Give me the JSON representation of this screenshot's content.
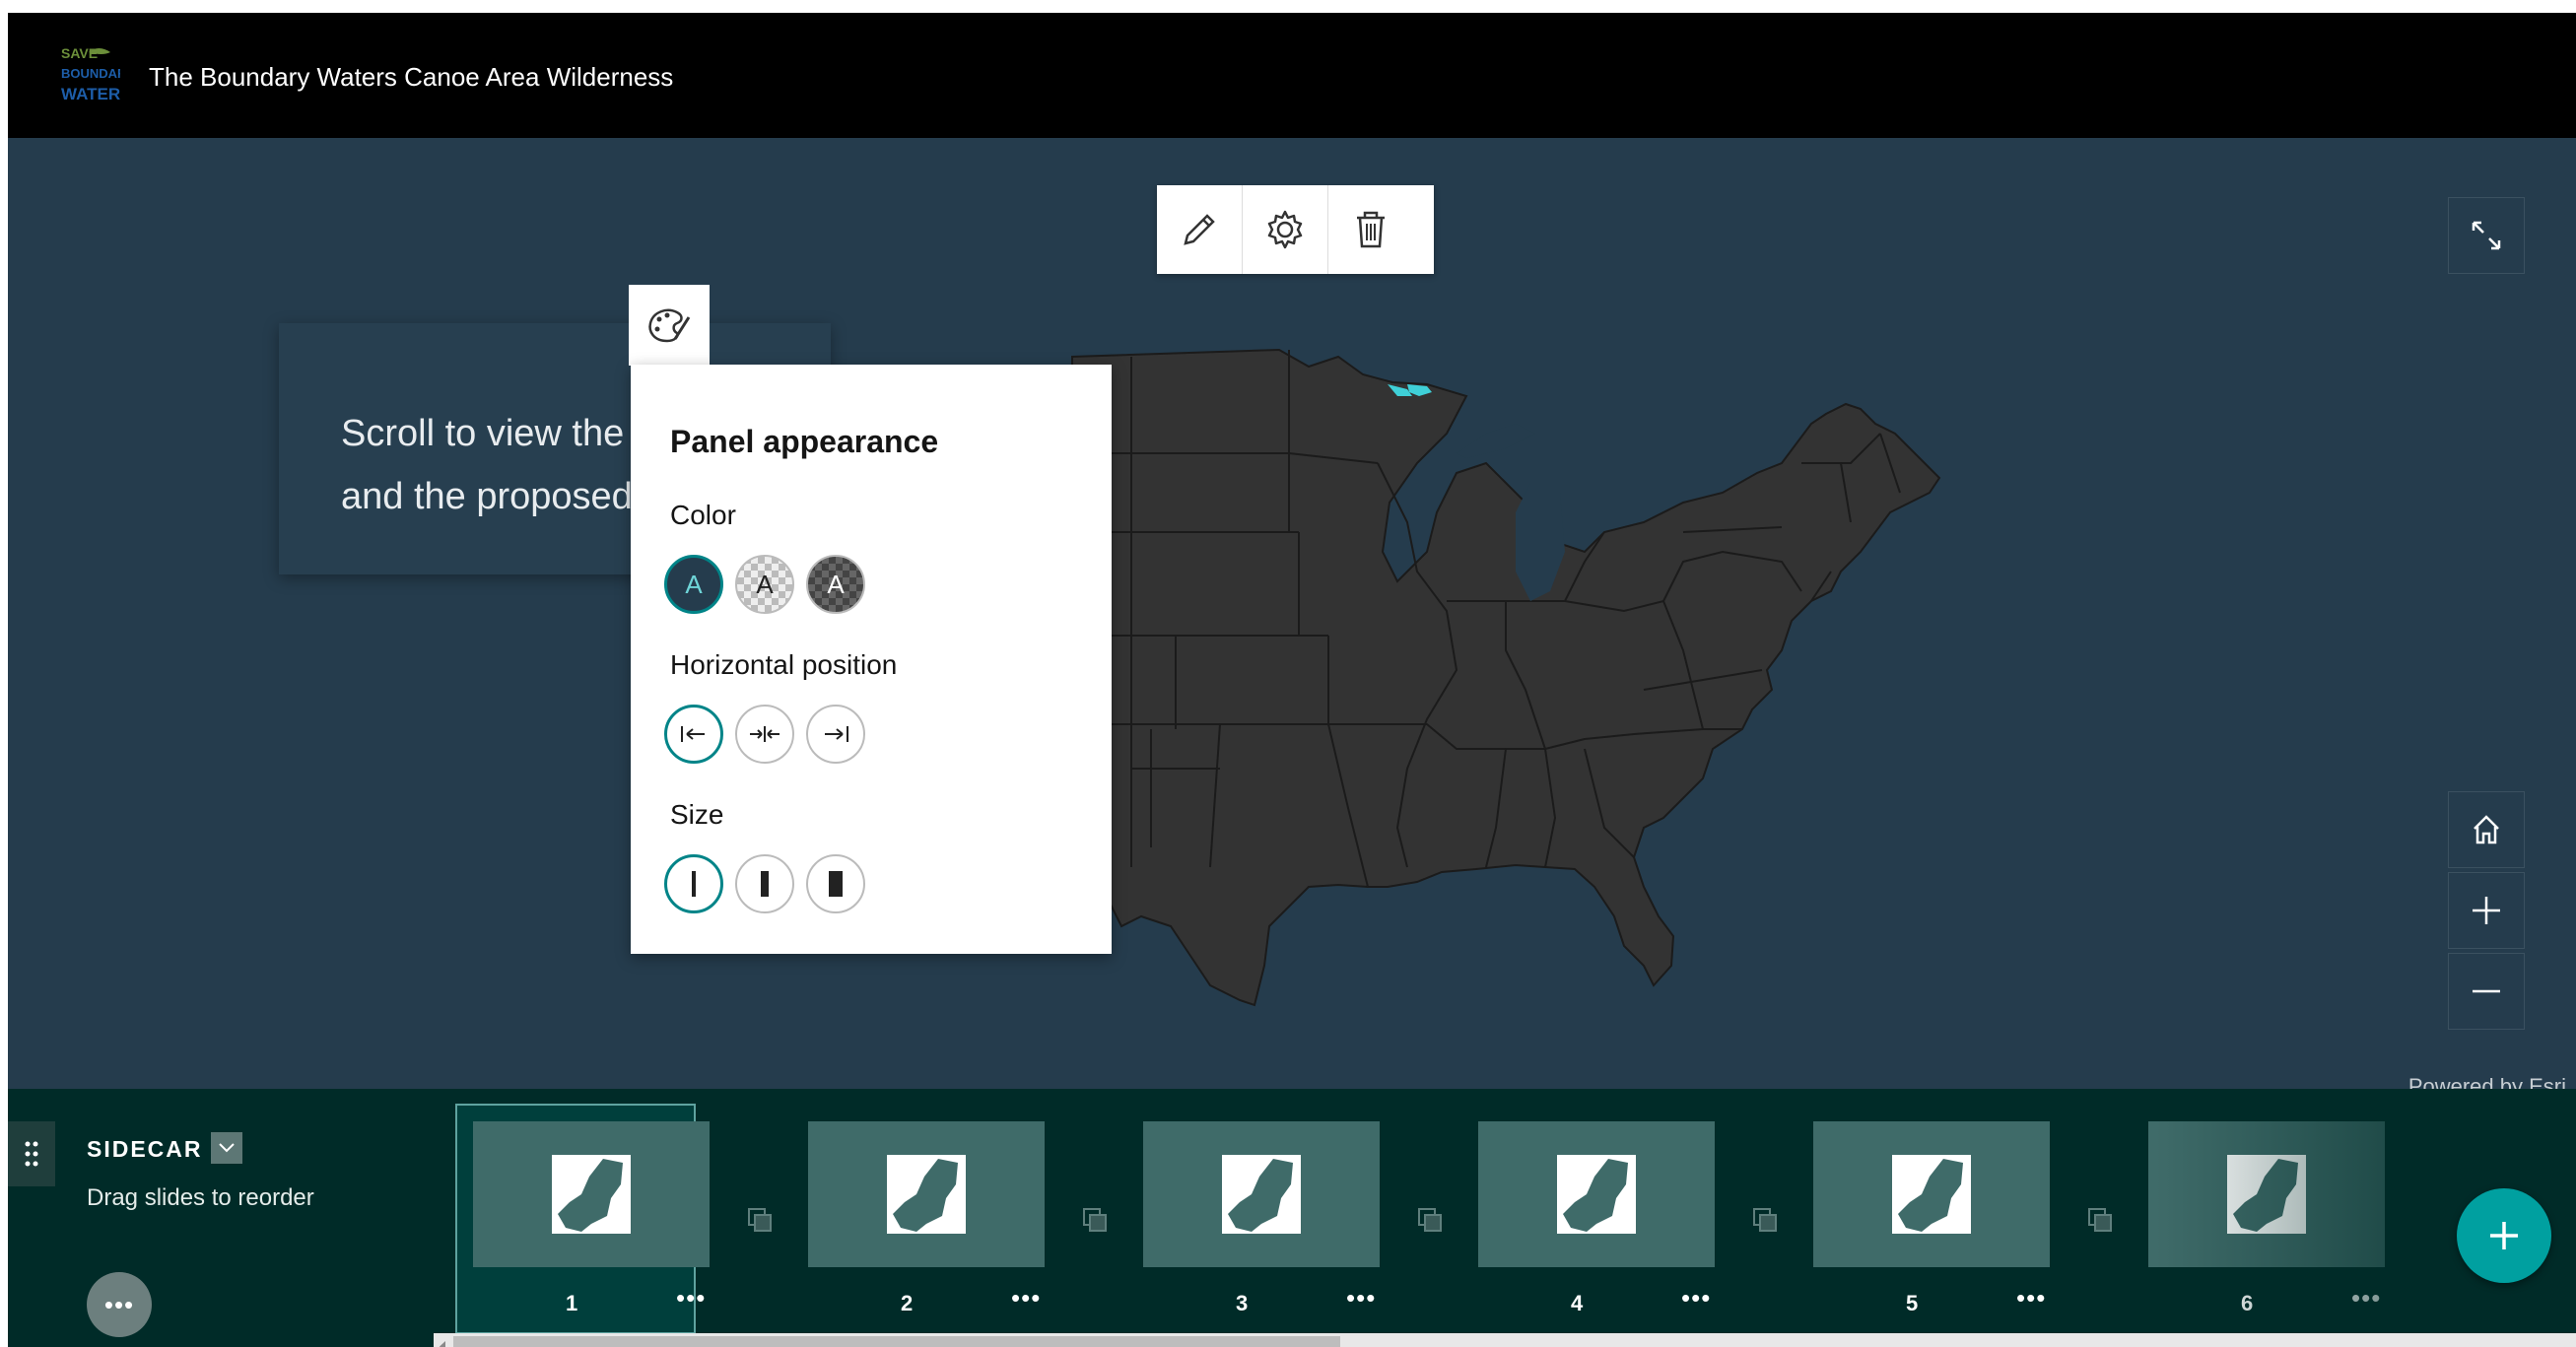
{
  "header": {
    "logo_lines": [
      "SAVE",
      "BOUNDARY",
      "WATERS"
    ],
    "title": "The Boundary Waters Canoe Area Wilderness"
  },
  "edit_toolbar": {
    "icons": [
      "pencil-icon",
      "gear-icon",
      "trash-icon"
    ]
  },
  "map": {
    "expand_icon": "expand-icon",
    "home_icon": "home-icon",
    "zoom_in_icon": "plus-icon",
    "zoom_out_icon": "minus-icon",
    "attribution": "Powered by Esri",
    "land_color": "#333333",
    "water_color": "#253c4d",
    "highlight_color": "#3fd0d8"
  },
  "narrative": {
    "line1": "Scroll to view the",
    "line2": "and the proposed"
  },
  "panel_appearance": {
    "title": "Panel appearance",
    "color_label": "Color",
    "color_options": [
      "A",
      "A",
      "A"
    ],
    "color_selected": 0,
    "horizontal_label": "Horizontal position",
    "horizontal_options": [
      "|←",
      "→|←",
      "→|"
    ],
    "horizontal_selected": 0,
    "size_label": "Size",
    "size_selected": 0,
    "accent_color": "#008488"
  },
  "sidecar": {
    "title": "SIDECAR",
    "subtitle": "Drag slides to reorder",
    "more_label": "•••",
    "slides": [
      {
        "number": "1",
        "selected": true
      },
      {
        "number": "2",
        "selected": false
      },
      {
        "number": "3",
        "selected": false
      },
      {
        "number": "4",
        "selected": false
      },
      {
        "number": "5",
        "selected": false
      },
      {
        "number": "6",
        "selected": false
      }
    ],
    "slide_menu_label": "•••",
    "add_icon": "plus-icon"
  }
}
